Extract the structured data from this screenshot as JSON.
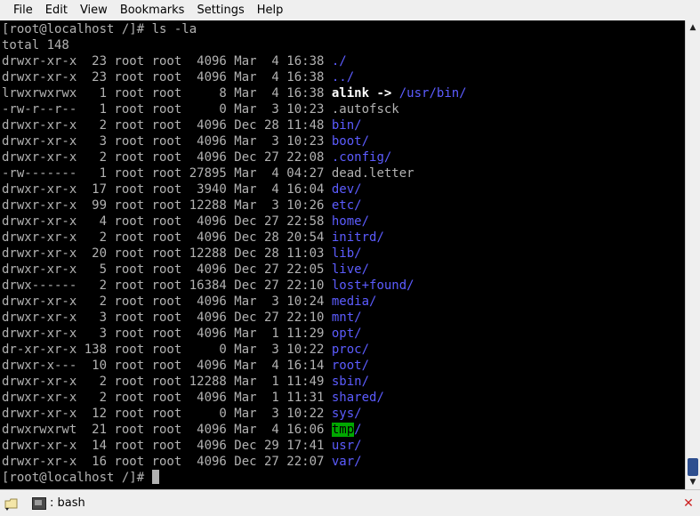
{
  "menu": [
    "File",
    "Edit",
    "View",
    "Bookmarks",
    "Settings",
    "Help"
  ],
  "terminal": {
    "prompt_cmd": "[root@localhost /]# ls -la",
    "total": "total 148",
    "rows": [
      {
        "meta": "drwxr-xr-x  23 root root  4096 Mar  4 16:38 ",
        "name": "./",
        "kind": "dir"
      },
      {
        "meta": "drwxr-xr-x  23 root root  4096 Mar  4 16:38 ",
        "name": "../",
        "kind": "dir"
      },
      {
        "meta": "lrwxrwxrwx   1 root root     8 Mar  4 16:38 ",
        "name": "alink",
        "arrow": " -> ",
        "target": "/usr/bin/",
        "kind": "link"
      },
      {
        "meta": "-rw-r--r--   1 root root     0 Mar  3 10:23 ",
        "name": ".autofsck",
        "kind": "plain"
      },
      {
        "meta": "drwxr-xr-x   2 root root  4096 Dec 28 11:48 ",
        "name": "bin/",
        "kind": "dir"
      },
      {
        "meta": "drwxr-xr-x   3 root root  4096 Mar  3 10:23 ",
        "name": "boot/",
        "kind": "dir"
      },
      {
        "meta": "drwxr-xr-x   2 root root  4096 Dec 27 22:08 ",
        "name": ".config/",
        "kind": "dir"
      },
      {
        "meta": "-rw-------   1 root root 27895 Mar  4 04:27 ",
        "name": "dead.letter",
        "kind": "plain"
      },
      {
        "meta": "drwxr-xr-x  17 root root  3940 Mar  4 16:04 ",
        "name": "dev/",
        "kind": "dir"
      },
      {
        "meta": "drwxr-xr-x  99 root root 12288 Mar  3 10:26 ",
        "name": "etc/",
        "kind": "dir"
      },
      {
        "meta": "drwxr-xr-x   4 root root  4096 Dec 27 22:58 ",
        "name": "home/",
        "kind": "dir"
      },
      {
        "meta": "drwxr-xr-x   2 root root  4096 Dec 28 20:54 ",
        "name": "initrd/",
        "kind": "dir"
      },
      {
        "meta": "drwxr-xr-x  20 root root 12288 Dec 28 11:03 ",
        "name": "lib/",
        "kind": "dir"
      },
      {
        "meta": "drwxr-xr-x   5 root root  4096 Dec 27 22:05 ",
        "name": "live/",
        "kind": "dir"
      },
      {
        "meta": "drwx------   2 root root 16384 Dec 27 22:10 ",
        "name": "lost+found/",
        "kind": "dir"
      },
      {
        "meta": "drwxr-xr-x   2 root root  4096 Mar  3 10:24 ",
        "name": "media/",
        "kind": "dir"
      },
      {
        "meta": "drwxr-xr-x   3 root root  4096 Dec 27 22:10 ",
        "name": "mnt/",
        "kind": "dir"
      },
      {
        "meta": "drwxr-xr-x   3 root root  4096 Mar  1 11:29 ",
        "name": "opt/",
        "kind": "dir"
      },
      {
        "meta": "dr-xr-xr-x 138 root root     0 Mar  3 10:22 ",
        "name": "proc/",
        "kind": "dir"
      },
      {
        "meta": "drwxr-x---  10 root root  4096 Mar  4 16:14 ",
        "name": "root/",
        "kind": "dir"
      },
      {
        "meta": "drwxr-xr-x   2 root root 12288 Mar  1 11:49 ",
        "name": "sbin/",
        "kind": "dir"
      },
      {
        "meta": "drwxr-xr-x   2 root root  4096 Mar  1 11:31 ",
        "name": "shared/",
        "kind": "dir"
      },
      {
        "meta": "drwxr-xr-x  12 root root     0 Mar  3 10:22 ",
        "name": "sys/",
        "kind": "dir"
      },
      {
        "meta": "drwxrwxrwt  21 root root  4096 Mar  4 16:06 ",
        "name": "tmp",
        "suffix": "/",
        "kind": "tmp"
      },
      {
        "meta": "drwxr-xr-x  14 root root  4096 Dec 29 17:41 ",
        "name": "usr/",
        "kind": "dir"
      },
      {
        "meta": "drwxr-xr-x  16 root root  4096 Dec 27 22:07 ",
        "name": "var/",
        "kind": "dir"
      }
    ],
    "prompt_final": "[root@localhost /]# "
  },
  "tab": {
    "label": ": bash"
  },
  "colors": {
    "dir": "#5c5cff",
    "fg": "#b2b2b2",
    "bg": "#000000",
    "tmp_bg": "#00a800"
  },
  "icons": {
    "new_tab": "new-tab-icon",
    "terminal": "terminal-icon",
    "close": "close-tab-icon"
  }
}
